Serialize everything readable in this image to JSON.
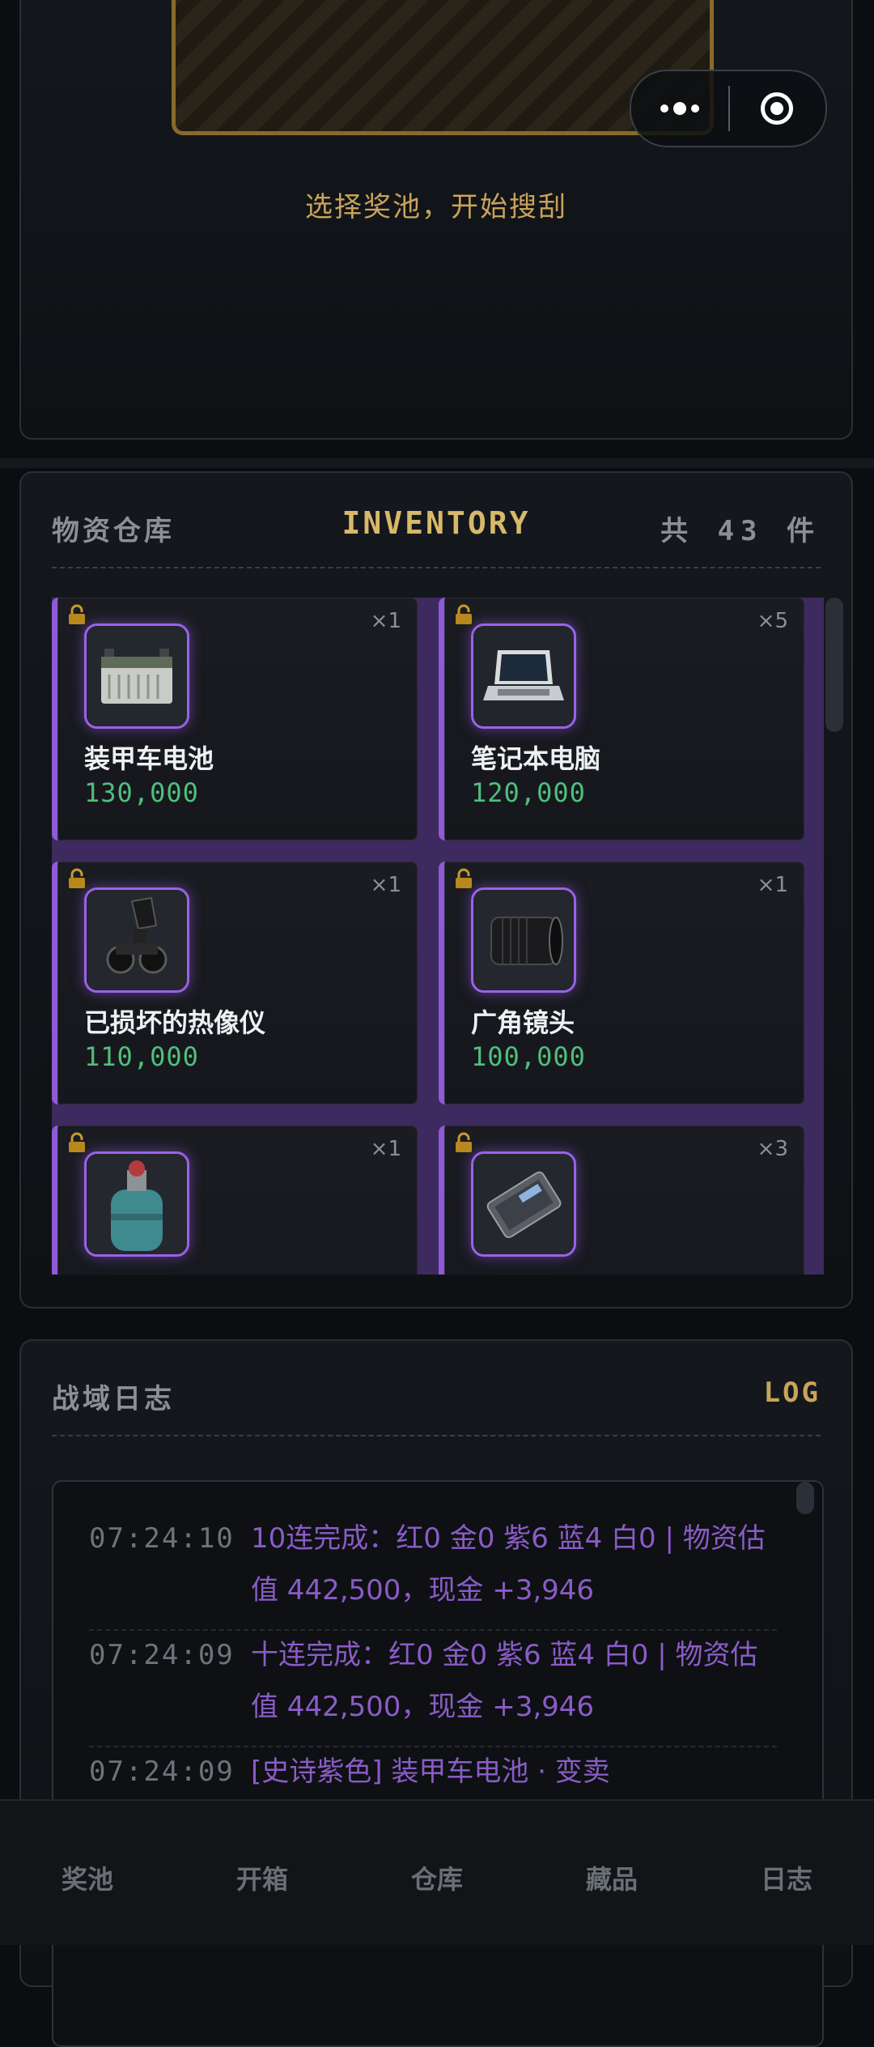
{
  "top": {
    "prompt": "选择奖池，开始搜刮"
  },
  "inventory": {
    "title_cn": "物资仓库",
    "title_en": "INVENTORY",
    "total_label": "共 43 件",
    "items": [
      {
        "name": "装甲车电池",
        "value": "130,000",
        "qty": "×1",
        "icon": "battery-icon"
      },
      {
        "name": "笔记本电脑",
        "value": "120,000",
        "qty": "×5",
        "icon": "laptop-icon"
      },
      {
        "name": "已损坏的热像仪",
        "value": "110,000",
        "qty": "×1",
        "icon": "thermal-imager-icon"
      },
      {
        "name": "广角镜头",
        "value": "100,000",
        "qty": "×1",
        "icon": "lens-icon"
      },
      {
        "name": "",
        "value": "",
        "qty": "×1",
        "icon": "gas-cylinder-icon"
      },
      {
        "name": "",
        "value": "",
        "qty": "×3",
        "icon": "ssd-icon"
      }
    ]
  },
  "log": {
    "title_cn": "战域日志",
    "title_en": "LOG",
    "entries": [
      {
        "time": "07:24:10",
        "text": "10连完成：红0 金0 紫6 蓝4 白0 | 物资估值 442,500，现金 +3,946"
      },
      {
        "time": "07:24:09",
        "text": "十连完成：红0 金0 紫6 蓝4 白0 | 物资估值 442,500，现金 +3,946"
      },
      {
        "time": "07:24:09",
        "text": "[史诗紫色] 装甲车电池 · 变卖"
      }
    ]
  },
  "tabs": [
    "奖池",
    "开箱",
    "仓库",
    "藏品",
    "日志"
  ],
  "colors": {
    "accent_gold": "#d8b86a",
    "epic_purple": "#8f5ad6",
    "value_green": "#4fbf7d"
  }
}
